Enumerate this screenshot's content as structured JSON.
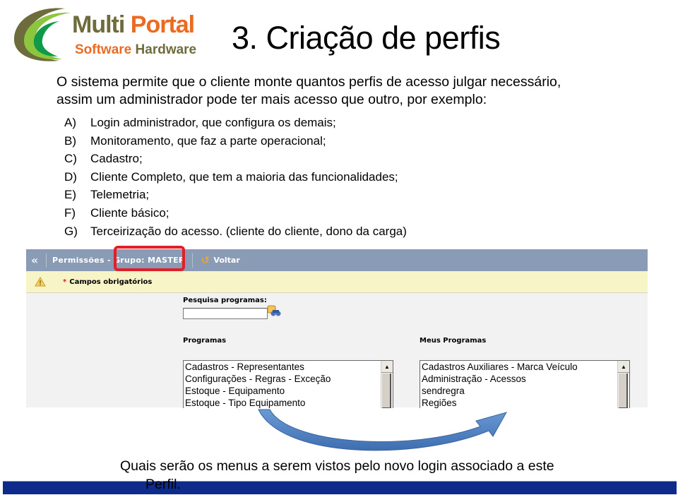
{
  "logo": {
    "line1_a": "Multi",
    "line1_b": "Portal",
    "line2_a": "Software",
    "line2_b": "Hardware",
    "colors": {
      "olive": "#6e6b3c",
      "orange": "#ec6b22",
      "green": "#8cc63f"
    }
  },
  "slide": {
    "title": "3. Criação de perfis",
    "intro_lines": [
      "O sistema permite que o cliente monte quantos perfis de acesso julgar necessário,",
      "assim um administrador pode ter mais acesso que outro, por exemplo:"
    ],
    "items": [
      {
        "mark": "A)",
        "text": "Login administrador, que configura os demais;"
      },
      {
        "mark": "B)",
        "text": "Monitoramento, que faz a parte operacional;"
      },
      {
        "mark": "C)",
        "text": "Cadastro;"
      },
      {
        "mark": "D)",
        "text": "Cliente Completo, que tem a maioria das funcionalidades;"
      },
      {
        "mark": "E)",
        "text": "Telemetria;"
      },
      {
        "mark": "F)",
        "text": "Cliente básico;"
      },
      {
        "mark": "G)",
        "text": " Terceirização do acesso. (cliente do cliente, dono da carga)"
      }
    ],
    "caption_line1": "Quais serão os menus a serem vistos pelo novo login associado a este",
    "caption_line2": "Perfil.",
    "bottom_bar_color": "#0e2a8a"
  },
  "app": {
    "toolbar": {
      "collapse_icon": "«",
      "title_prefix": "Permissões - ",
      "group_label": "Grupo: MASTER",
      "back_icon": "↺",
      "back_label": "Voltar",
      "color": "#8a9bb6"
    },
    "notice": {
      "star": "*",
      "text": "Campos obrigatórios",
      "color": "#f7f4c8"
    },
    "search": {
      "label": "Pesquisa programas:",
      "value": "",
      "placeholder": ""
    },
    "programs": {
      "label": "Programas",
      "options": [
        "Cadastros - Representantes",
        "Configurações - Regras - Exceção",
        "Estoque - Equipamento",
        "Estoque - Tipo Equipamento"
      ]
    },
    "my_programs": {
      "label": "Meus Programas",
      "options": [
        "Cadastros Auxiliares - Marca Veículo",
        "Administração - Acessos",
        "sendregra",
        "Regiões"
      ]
    },
    "highlight_color": "#e31e24",
    "arrow_color": "#4a7ebb"
  }
}
